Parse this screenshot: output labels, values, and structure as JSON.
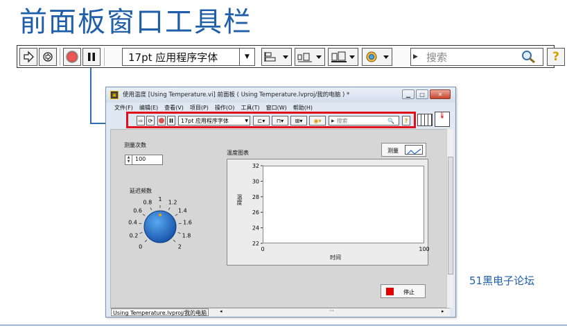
{
  "slide": {
    "title": "前面板窗口工具栏",
    "watermark": "51黑电子论坛"
  },
  "toolbar": {
    "font_label": "17pt 应用程序字体",
    "search_placeholder": "搜索",
    "help_label": "?"
  },
  "window": {
    "title": "使用温度 [Using Temperature.vi] 前面板 ( Using Temperature.lvproj/我的电脑 ) *",
    "menus": [
      "文件(F)",
      "编辑(E)",
      "查看(V)",
      "项目(P)",
      "操作(O)",
      "工具(T)",
      "窗口(W)",
      "帮助(H)"
    ],
    "toolbar": {
      "font_label": "17pt 应用程序字体",
      "search_placeholder": "搜索"
    },
    "status_path": "Using Temperature.lvproj/我的电脑",
    "controls": {
      "count_label": "测量次数",
      "count_value": "100",
      "delay_label": "延迟频数",
      "knob_ticks": [
        "0",
        "0.2",
        "0.4",
        "0.6",
        "0.8",
        "1",
        "1.2",
        "1.4",
        "1.6",
        "1.8",
        "2"
      ],
      "knob_value": 1,
      "graph_label": "温度图表",
      "plot_button": "测量",
      "stop_button": "停止"
    }
  },
  "chart_data": {
    "type": "line",
    "title": "温度图表",
    "xlabel": "时间",
    "ylabel": "温度",
    "xlim": [
      0,
      100
    ],
    "ylim": [
      22,
      32
    ],
    "x_ticks": [
      "0",
      "100"
    ],
    "y_ticks": [
      "22",
      "24",
      "26",
      "28",
      "30",
      "32"
    ],
    "series": []
  }
}
